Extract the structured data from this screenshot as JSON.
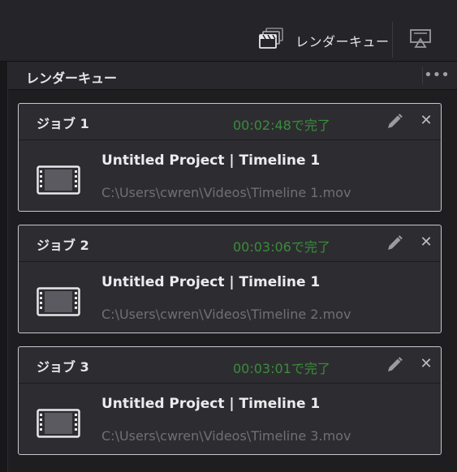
{
  "topbar": {
    "render_queue_label": "レンダーキュー",
    "render_queue_icon": "clapperboard-stack-icon",
    "viewer_icon": "display-viewer-icon"
  },
  "panel": {
    "title": "レンダーキュー",
    "menu_icon": "more-options-icon",
    "menu_glyph": "•••"
  },
  "jobs": [
    {
      "name": "ジョブ 1",
      "status": "00:02:48で完了",
      "project": "Untitled Project | Timeline 1",
      "path": "C:\\Users\\cwren\\Videos\\Timeline 1.mov"
    },
    {
      "name": "ジョブ 2",
      "status": "00:03:06で完了",
      "project": "Untitled Project | Timeline 1",
      "path": "C:\\Users\\cwren\\Videos\\Timeline 2.mov"
    },
    {
      "name": "ジョブ 3",
      "status": "00:03:01で完了",
      "project": "Untitled Project | Timeline 1",
      "path": "C:\\Users\\cwren\\Videos\\Timeline 3.mov"
    }
  ],
  "icons": {
    "edit": "pencil-icon",
    "close": "close-icon",
    "close_glyph": "✕",
    "film": "film-strip-icon"
  },
  "colors": {
    "status_complete": "#3a8d3a",
    "job_border": "#c8c8cc",
    "path_text": "#6f6f75"
  }
}
